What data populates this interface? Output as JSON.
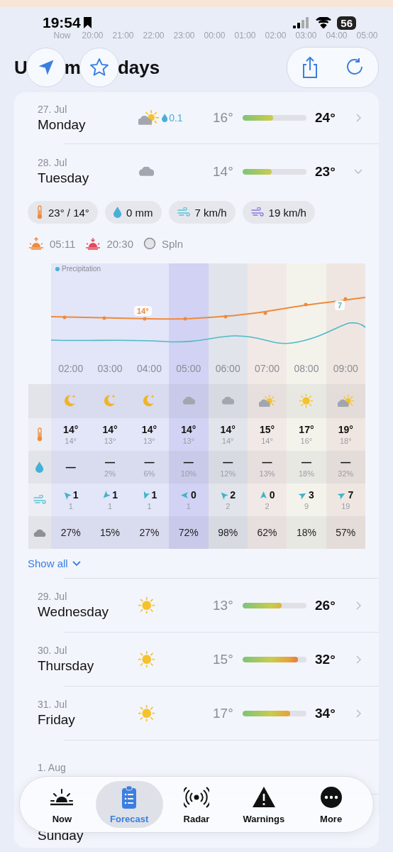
{
  "status_bar": {
    "time": "19:54",
    "battery": "56"
  },
  "background_strip": {
    "hours": [
      {
        "label": "Now"
      },
      {
        "label": "20:00"
      },
      {
        "label": "21:00"
      },
      {
        "label": "22:00"
      },
      {
        "label": "23:00"
      },
      {
        "label": "00:00"
      },
      {
        "label": "01:00"
      },
      {
        "label": "02:00"
      },
      {
        "label": "03:00"
      },
      {
        "label": "04:00"
      },
      {
        "label": "05:00"
      }
    ]
  },
  "header": {
    "title_parts": [
      "U",
      "m",
      "days"
    ]
  },
  "days": [
    {
      "date": "27. Jul",
      "day": "Monday",
      "kind": "partly",
      "precip": "0.1",
      "low": "16°",
      "high": "24°",
      "level": 0.48,
      "expanded": false
    },
    {
      "date": "28. Jul",
      "day": "Tuesday",
      "kind": "cloud",
      "low": "14°",
      "high": "23°",
      "level": 0.45,
      "expanded": true,
      "details": {
        "chips": [
          {
            "kind": "temp",
            "text": "23° / 14°"
          },
          {
            "kind": "rain",
            "text": "0 mm"
          },
          {
            "kind": "wind",
            "text": "7 km/h"
          },
          {
            "kind": "gust",
            "text": "19 km/h"
          }
        ],
        "sun": {
          "sunrise": "05:11",
          "sunset": "20:30",
          "moon": "Spln"
        },
        "chart": {
          "legend": "Precipitation",
          "temp_label": "14°",
          "wind_label": "7"
        },
        "hours": [
          {
            "time": "02:00",
            "color": "#e3e5f8",
            "kind": "moon",
            "temp": "14°",
            "feels": "14°",
            "rain": "—",
            "wind": "1",
            "gust": "1",
            "cloud": "27%"
          },
          {
            "time": "03:00",
            "color": "#e3e5f8",
            "kind": "moon",
            "temp": "14°",
            "feels": "13°",
            "rain": "—",
            "rain_prob": "2%",
            "wind": "1",
            "gust": "1",
            "cloud": "15%"
          },
          {
            "time": "04:00",
            "color": "#e3e5f8",
            "kind": "moon",
            "temp": "14°",
            "feels": "13°",
            "rain": "—",
            "rain_prob": "6%",
            "wind": "1",
            "gust": "1",
            "cloud": "27%"
          },
          {
            "time": "05:00",
            "color": "#d2d2f4",
            "kind": "cloud",
            "temp": "14°",
            "feels": "13°",
            "rain": "—",
            "rain_prob": "10%",
            "wind": "0",
            "gust": "1",
            "cloud": "72%"
          },
          {
            "time": "06:00",
            "color": "#e2e4eb",
            "kind": "cloud",
            "temp": "14°",
            "feels": "14°",
            "rain": "—",
            "rain_prob": "12%",
            "wind": "2",
            "gust": "2",
            "cloud": "98%"
          },
          {
            "time": "07:00",
            "color": "#f1e9e6",
            "kind": "partly",
            "temp": "15°",
            "feels": "14°",
            "rain": "—",
            "rain_prob": "13%",
            "wind": "0",
            "gust": "2",
            "cloud": "62%"
          },
          {
            "time": "08:00",
            "color": "#f3f3ec",
            "kind": "sun",
            "temp": "17°",
            "feels": "16°",
            "rain": "—",
            "rain_prob": "18%",
            "wind": "3",
            "gust": "9",
            "cloud": "18%"
          },
          {
            "time": "09:00",
            "color": "#efe6e2",
            "kind": "partly",
            "temp": "19°",
            "feels": "18°",
            "rain": "—",
            "rain_prob": "32%",
            "wind": "7",
            "gust": "19",
            "cloud": "57%"
          }
        ],
        "show_all": "Show all"
      }
    },
    {
      "date": "29. Jul",
      "day": "Wednesday",
      "kind": "sun",
      "low": "13°",
      "high": "26°",
      "level": 0.61,
      "expanded": false
    },
    {
      "date": "30. Jul",
      "day": "Thursday",
      "kind": "sun",
      "low": "15°",
      "high": "32°",
      "level": 0.87,
      "expanded": false
    },
    {
      "date": "31. Jul",
      "day": "Friday",
      "kind": "sun",
      "low": "17°",
      "high": "34°",
      "level": 0.74,
      "expanded": false
    },
    {
      "date": "1. Aug"
    },
    {
      "day": "Sunday"
    }
  ],
  "tab_bar": [
    {
      "label": "Now",
      "selected": false
    },
    {
      "label": "Forecast",
      "selected": true
    },
    {
      "label": "Radar",
      "selected": false
    },
    {
      "label": "Warnings",
      "selected": false
    },
    {
      "label": "More",
      "selected": false
    }
  ]
}
